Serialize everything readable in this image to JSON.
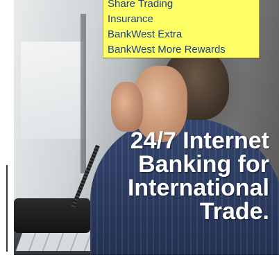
{
  "menu": {
    "items": [
      {
        "label": "Share Trading"
      },
      {
        "label": "Insurance"
      },
      {
        "label": "BankWest Extra"
      },
      {
        "label": "BankWest More Rewards"
      }
    ]
  },
  "banner": {
    "headline_lines": [
      "24/7 Internet",
      "Banking for",
      "International",
      "Trade."
    ]
  },
  "colors": {
    "menu_background": "#ffff66",
    "menu_text": "#1a3f8a",
    "headline_text": "#ffffff"
  }
}
